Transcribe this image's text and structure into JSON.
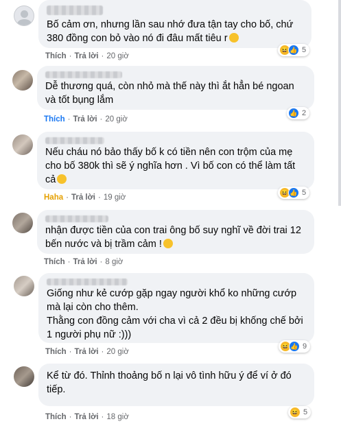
{
  "comments": [
    {
      "text": "Bố cảm ơn, nhưng lần sau nhớ đưa tận tay cho bố, chứ 380 đồng con bỏ vào nó đi đâu mất tiêu r",
      "emoji": "worried-face-emoji",
      "reactions": [
        "haha",
        "like"
      ],
      "reaction_count": "5",
      "action": "Thích",
      "reply": "Trả lời",
      "time": "20 giờ"
    },
    {
      "text": "Dễ thương quá, còn nhỏ mà thế này thì ắt hẳn bé ngoan và tốt bụng lắm",
      "reactions": [
        "like"
      ],
      "reaction_count": "2",
      "action": "Thích",
      "reply": "Trả lời",
      "time": "20 giờ"
    },
    {
      "text": "Nếu cháu nó bảo thấy bố k có tiền nên con trộm của mẹ cho bố 380k thì sẽ ý nghĩa hơn . Vì bố con có thể làm tất cả",
      "emoji": "rofl-emoji",
      "reactions": [
        "haha",
        "like"
      ],
      "reaction_count": "5",
      "action": "Haha",
      "reply": "Trả lời",
      "time": "19 giờ"
    },
    {
      "text": "nhận được tiền của con trai ông bố suy nghĩ về đời trai 12 bến nước và bị trầm cảm !",
      "emoji": "laughing-emoji",
      "action": "Thích",
      "reply": "Trả lời",
      "time": "8 giờ"
    },
    {
      "text": "Giống như kẻ cướp gặp ngay người khổ ko những cướp mà lại còn cho thêm.\nThằng con đồng cảm với cha vì cả 2 đều bị khống chế bởi 1 người phụ nữ :)))",
      "reactions": [
        "haha",
        "like"
      ],
      "reaction_count": "9",
      "action": "Thích",
      "reply": "Trả lời",
      "time": "20 giờ"
    },
    {
      "text": "Kể từ đó. Thỉnh thoảng bố n lại vô tình hữu ý để ví ở đó tiếp.",
      "reactions": [
        "haha"
      ],
      "reaction_count": "5",
      "action": "Thích",
      "reply": "Trả lời",
      "time": "18 giờ"
    }
  ],
  "separator": "·"
}
